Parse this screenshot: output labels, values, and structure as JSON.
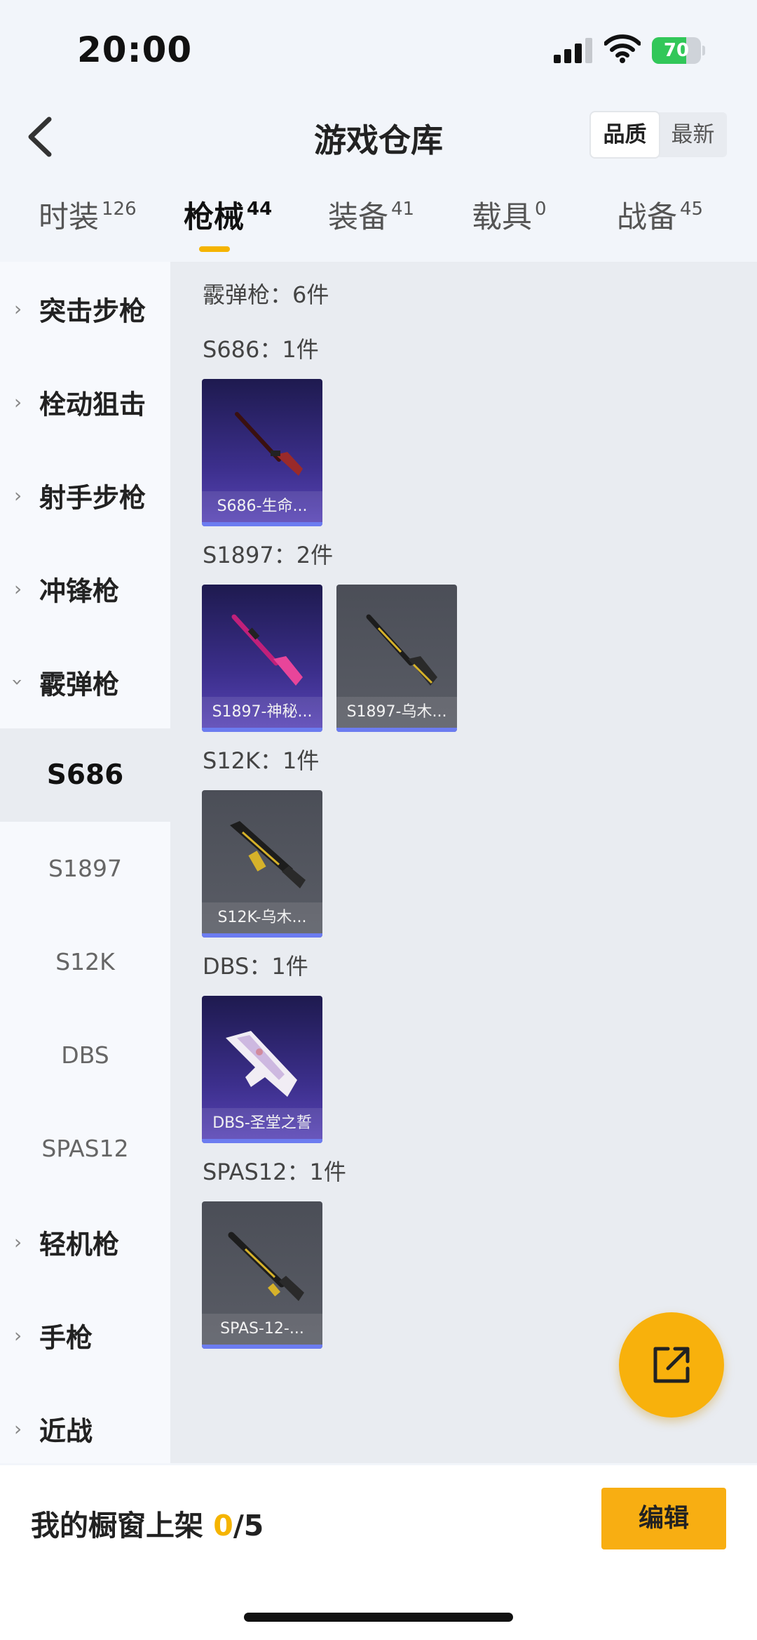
{
  "status_bar": {
    "time": "20:00",
    "battery": "70",
    "battery_level": 0.7
  },
  "header": {
    "title": "游戏仓库",
    "back_icon": "chevron-left-icon"
  },
  "sort": {
    "options": [
      "品质",
      "最新"
    ],
    "active": "品质"
  },
  "tabs": [
    {
      "label": "时装",
      "count": "126"
    },
    {
      "label": "枪械",
      "count": "44"
    },
    {
      "label": "装备",
      "count": "41"
    },
    {
      "label": "载具",
      "count": "0"
    },
    {
      "label": "战备",
      "count": "45"
    }
  ],
  "active_tab": "枪械",
  "colors": {
    "accent": "#f5b400",
    "stripe_blue": "#6c7cf0",
    "card_purple": "#3c2f8c",
    "card_gray": "#55585f"
  },
  "sidebar": {
    "categories": [
      "突击步枪",
      "栓动狙击",
      "射手步枪",
      "冲锋枪",
      "霰弹枪"
    ],
    "subitems": [
      "S686",
      "S1897",
      "S12K",
      "DBS",
      "SPAS12"
    ],
    "active_sub": "S686",
    "after": [
      "轻机枪",
      "手枪",
      "近战"
    ]
  },
  "content": {
    "category_title": "霰弹枪：6件",
    "groups": [
      {
        "title": "S686：1件",
        "items": [
          {
            "label": "S686-生命...",
            "rarity": "purple",
            "icon": "double-barrel-shotgun-icon"
          }
        ]
      },
      {
        "title": "S1897：2件",
        "items": [
          {
            "label": "S1897-神秘...",
            "rarity": "purple",
            "icon": "pump-shotgun-pink-icon"
          },
          {
            "label": "S1897-乌木...",
            "rarity": "gray",
            "icon": "pump-shotgun-gold-icon"
          }
        ]
      },
      {
        "title": "S12K：1件",
        "items": [
          {
            "label": "S12K-乌木...",
            "rarity": "gray",
            "icon": "auto-shotgun-icon"
          }
        ]
      },
      {
        "title": "DBS：1件",
        "items": [
          {
            "label": "DBS-圣堂之誓",
            "rarity": "purple",
            "icon": "bullpup-shotgun-icon"
          }
        ]
      },
      {
        "title": "SPAS12：1件",
        "items": [
          {
            "label": "SPAS-12-...",
            "rarity": "gray",
            "icon": "spas-shotgun-icon"
          }
        ]
      }
    ]
  },
  "fab": {
    "icon": "share-external-icon"
  },
  "bottom": {
    "prefix": "我的橱窗上架",
    "current": "0",
    "total": "/5",
    "edit_label": "编辑"
  }
}
